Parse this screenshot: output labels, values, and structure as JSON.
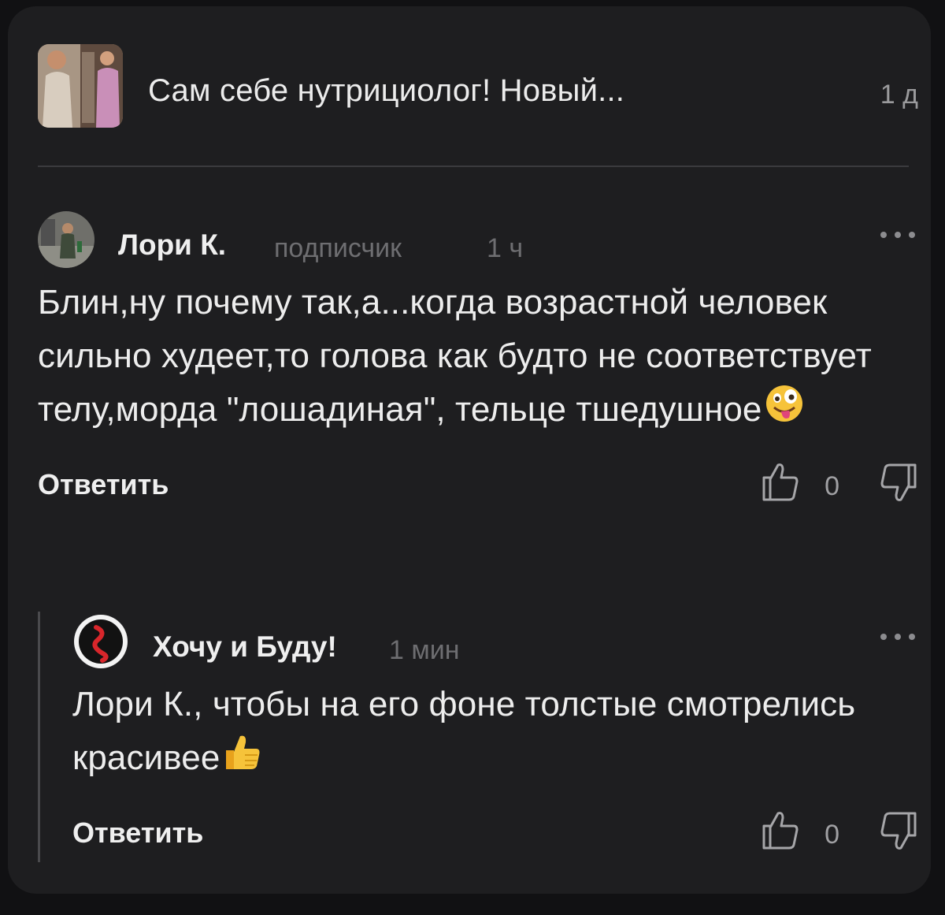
{
  "article": {
    "title": "Сам себе нутрициолог! Новый...",
    "age": "1 д"
  },
  "comments": [
    {
      "author": "Лори К.",
      "role": "подписчик",
      "time": "1 ч",
      "text": "Блин,ну почему так,а...когда возрастной человек сильно худеет,то голова как будто не соответствует телу,морда \"лошадиная\", тельце тшедушное",
      "emoji": "zany-face-emoji",
      "reply_label": "Ответить",
      "likes": "0"
    },
    {
      "author": "Хочу и Буду!",
      "time": "1 мин",
      "text": "Лори К., чтобы на его фоне толстые смотрелись красивее",
      "emoji": "thumbs-up-emoji",
      "reply_label": "Ответить",
      "likes": "0"
    }
  ],
  "colors": {
    "background": "#111113",
    "card": "#1e1e20",
    "text": "#ededed",
    "muted": "#6e6e71"
  }
}
